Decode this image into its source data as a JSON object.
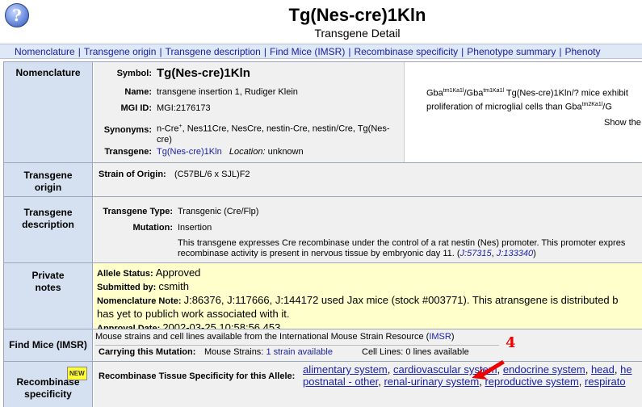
{
  "header": {
    "help_icon_glyph": "?",
    "title": "Tg(Nes-cre)1Kln",
    "subtitle": "Transgene Detail"
  },
  "nav": {
    "items": [
      "Nomenclature",
      "Transgene origin",
      "Transgene description",
      "Find Mice (IMSR)",
      "Recombinase specificity",
      "Phenotype summary",
      "Phenoty"
    ],
    "separator": "|"
  },
  "nomenclature": {
    "row_label": "Nomenclature",
    "symbol_label": "Symbol:",
    "symbol_value": "Tg(Nes-cre)1Kln",
    "name_label": "Name:",
    "name_value": "transgene insertion 1, Rudiger Klein",
    "mgi_label": "MGI ID:",
    "mgi_value": "MGI:2176173",
    "synonyms_label": "Synonyms:",
    "synonyms_pre": "n-Cre",
    "synonyms_sup": "+",
    "synonyms_line1_rest": ", Nes11Cre, NesCre, nestin-Cre, nestin/Cre, Tg(Nes-",
    "synonyms_line2": "cre)",
    "transgene_label": "Transgene:",
    "transgene_value": "Tg(Nes-cre)1Kln",
    "location_label": "Location:",
    "location_value": "unknown",
    "side_g1": "Gba",
    "side_g1_sup": "tm1Ka1l",
    "side_slash": "/Gba",
    "side_g2_sup": "tm1Ka1l",
    "side_line1_rest": " Tg(Nes-cre)1Kln/? mice exhibit",
    "side_line2_pre": "proliferation of microglial cells than Gba",
    "side_line2_sup": "tm2Ka1l",
    "side_line2_rest": "/G",
    "side_show": "Show the"
  },
  "transgene_origin": {
    "row_label": "Transgene origin",
    "strain_label": "Strain of Origin:",
    "strain_value": "(C57BL/6 x SJL)F2"
  },
  "transgene_description": {
    "row_label": "Transgene description",
    "type_label": "Transgene Type:",
    "type_value": "Transgenic (Cre/Flp)",
    "mutation_label": "Mutation:",
    "mutation_value": "Insertion",
    "desc_line1": "This transgene expresses Cre recombinase under the control of a rat nestin (Nes) promoter. This promoter expres",
    "desc_line2_pre": "recombinase activity is present in nervous tissue by embryonic day 11. (",
    "desc_ref1": "J:57315",
    "desc_comma": ", ",
    "desc_ref2": "J:133340",
    "desc_close": ")"
  },
  "private_notes": {
    "row_label": "Private notes",
    "status_label": "Allele Status:",
    "status_value": "Approved",
    "submitted_label": "Submitted by:",
    "submitted_value": "csmith",
    "note_label": "Nomenclature Note:",
    "note_line1": "J:86376, J:117666, J:144172 used Jax mice (stock #003771). This atransgene is distributed b",
    "note_line2": "has yet to publich work associated with it.",
    "approval_label": "Approval Date:",
    "approval_value": "2002-03-25 10:58:56.453"
  },
  "find_mice": {
    "row_label": "Find Mice (IMSR)",
    "line1_pre": "Mouse strains and cell lines available from the International Mouse Strain Resource (",
    "imsr_link": "IMSR",
    "line1_post": ")",
    "carrying_label": "Carrying this Mutation:",
    "strains_label": "Mouse Strains:",
    "strains_value": "1 strain available",
    "cell_lines_label": "Cell Lines:",
    "cell_lines_value": "0 lines available"
  },
  "recombinase": {
    "new_badge": "NEW",
    "row_label": "Recombinase specificity",
    "tissue_label": "Recombinase Tissue Specificity for this Allele:",
    "tissues_line1": [
      "alimentary system",
      "cardiovascular system",
      "endocrine system",
      "head",
      "he"
    ],
    "tissues_line2": [
      "postnatal - other",
      "renal-urinary system",
      "reproductive system",
      "respirato"
    ],
    "annotation_number": "4",
    "annotation_color": "#ee0000"
  },
  "colors": {
    "link": "#1a22a6",
    "label_bg": "#d5e0f0",
    "content_bg": "#f0f0f0",
    "notes_bg": "#ffffcc",
    "nav_bg": "#dfe8f6"
  }
}
